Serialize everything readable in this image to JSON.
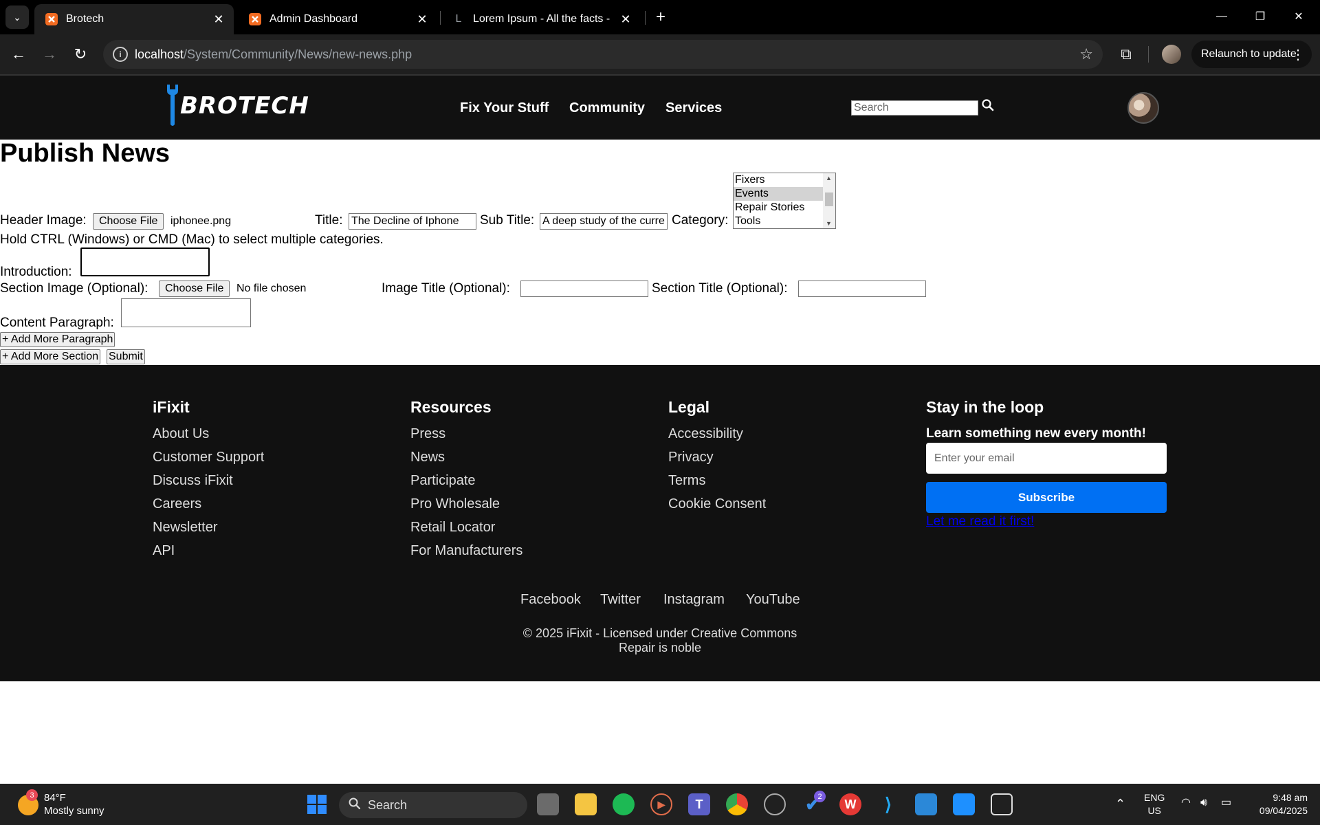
{
  "browser": {
    "tabs": [
      {
        "title": "Brotech",
        "favicon_color": "#f26b21"
      },
      {
        "title": "Admin Dashboard",
        "favicon_color": "#f26b21"
      },
      {
        "title": "Lorem Ipsum - All the facts - Lip",
        "favicon_color": "#9aa0a6"
      }
    ],
    "url_host": "localhost",
    "url_path": "/System/Community/News/new-news.php",
    "relaunch_label": "Relaunch to update"
  },
  "header": {
    "logo_text": "BROTECH",
    "nav": [
      "Fix Your Stuff",
      "Community",
      "Services"
    ],
    "search_placeholder": "Search"
  },
  "form": {
    "page_title": "Publish News",
    "header_image_label": "Header Image:",
    "choose_file_label": "Choose File",
    "header_file_name": "iphonee.png",
    "title_label": "Title:",
    "title_value": "The Decline of Iphone",
    "subtitle_label": "Sub Title:",
    "subtitle_value": "A deep study of the curre",
    "category_label": "Category:",
    "categories": [
      {
        "label": "Fixers",
        "selected": false
      },
      {
        "label": "Events",
        "selected": true
      },
      {
        "label": "Repair Stories",
        "selected": false
      },
      {
        "label": "Tools",
        "selected": false
      }
    ],
    "category_hint": "Hold CTRL (Windows) or CMD (Mac) to select multiple categories.",
    "introduction_label": "Introduction:",
    "section_image_label": "Section Image (Optional):",
    "section_file_name": "No file chosen",
    "image_title_label": "Image Title (Optional):",
    "section_title_label": "Section Title (Optional):",
    "content_paragraph_label": "Content Paragraph:",
    "add_paragraph_label": "+ Add More Paragraph",
    "add_section_label": "+ Add More Section",
    "submit_label": "Submit"
  },
  "footer": {
    "columns": [
      {
        "heading": "iFixit",
        "links": [
          "About Us",
          "Customer Support",
          "Discuss iFixit",
          "Careers",
          "Newsletter",
          "API"
        ]
      },
      {
        "heading": "Resources",
        "links": [
          "Press",
          "News",
          "Participate",
          "Pro Wholesale",
          "Retail Locator",
          "For Manufacturers"
        ]
      },
      {
        "heading": "Legal",
        "links": [
          "Accessibility",
          "Privacy",
          "Terms",
          "Cookie Consent"
        ]
      }
    ],
    "newsletter": {
      "heading": "Stay in the loop",
      "subheading": "Learn something new every month!",
      "email_placeholder": "Enter your email",
      "subscribe_label": "Subscribe",
      "read_first_label": "Let me read it first!"
    },
    "social": [
      "Facebook",
      "Twitter",
      "Instagram",
      "YouTube"
    ],
    "copyright": "© 2025 iFixit - Licensed under Creative Commons",
    "tagline": "Repair is noble"
  },
  "taskbar": {
    "weather_temp": "84°F",
    "weather_desc": "Mostly sunny",
    "weather_badge": "3",
    "search_label": "Search",
    "todo_badge": "2",
    "lang_top": "ENG",
    "lang_bottom": "US",
    "time": "9:48 am",
    "date": "09/04/2025"
  },
  "colors": {
    "header_bg": "#111111",
    "subscribe_blue": "#0070f3",
    "logo_blue": "#1e88e5"
  }
}
